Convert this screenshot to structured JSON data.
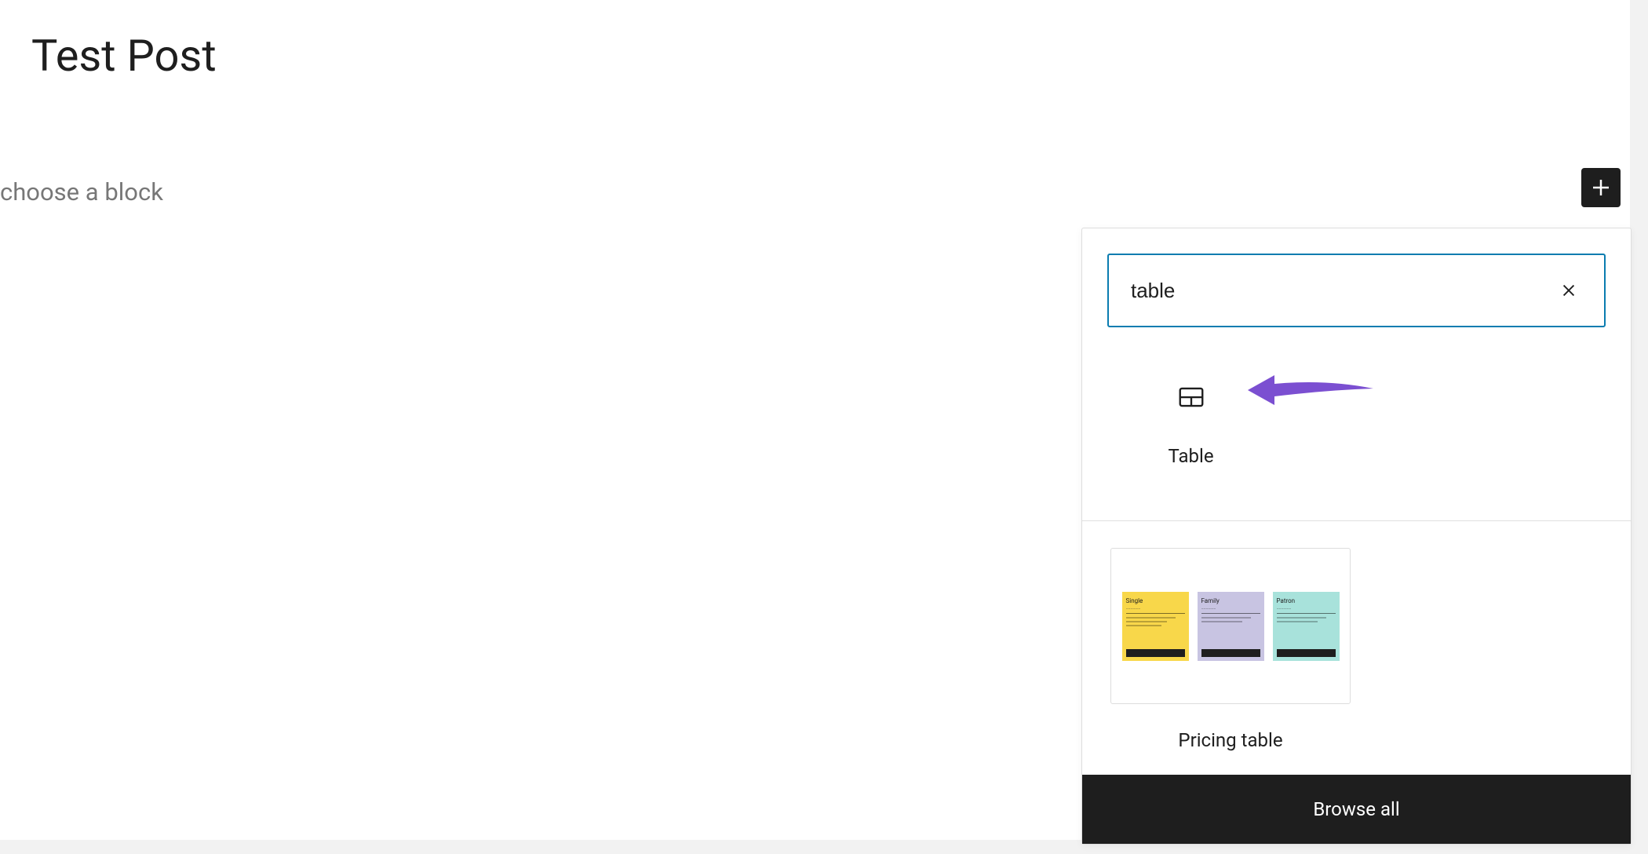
{
  "editor": {
    "post_title": "Test Post",
    "placeholder_hint": "choose a block"
  },
  "inserter": {
    "search_value": "table",
    "blocks": [
      {
        "label": "Table"
      }
    ],
    "patterns": [
      {
        "label": "Pricing table",
        "columns": [
          {
            "title": "Single"
          },
          {
            "title": "Family"
          },
          {
            "title": "Patron"
          }
        ]
      }
    ],
    "browse_all_label": "Browse all"
  }
}
